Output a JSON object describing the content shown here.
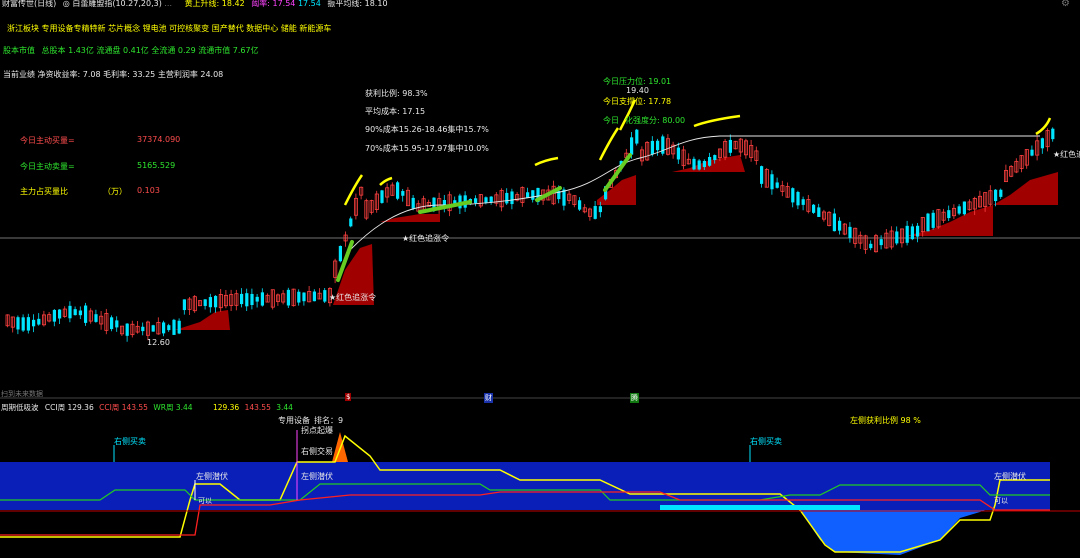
{
  "titlebar": {
    "app": "财富传世(日线)",
    "name": "◎ 白蕾雕盟指(10.27,20,3)",
    "extra": "...",
    "l1": "黄上升线: 18.42",
    "l2": "阈率: 17.54",
    "l3": "17.54",
    "l4": "振平均线: 18.10"
  },
  "info": {
    "line1": "浙江板块  专用设备专精特新 芯片概念 锂电池 可控核聚变 国产替代 数据中心 储能 新能源车",
    "line2_label": "股本市值",
    "line2": "总股本 1.43亿  流通盘 0.41亿 全流通  0.29 流通市值 7.67亿",
    "line3": "当前业绩  净资收益率: 7.08  毛利率: 33.25  主营利润率 24.08"
  },
  "left_stats": [
    {
      "label": "今日主动买量=",
      "value": "37374.090",
      "color": "#ff4d4d"
    },
    {
      "label": "今日主动卖量=",
      "value": "5165.529",
      "color": "#2ee62e"
    },
    {
      "label": "主力占买量比",
      "unit": "（万）",
      "value": "0.103",
      "color": "#ffff00"
    }
  ],
  "center_stats": [
    "获利比例: 98.3%",
    "平均成本: 17.15",
    "90%成本15.26-18.46集中15.7%",
    "70%成本15.95-17.97集中10.0%"
  ],
  "right_stats": {
    "pressure": "今日压力位: 19.01",
    "price_top": "19.40",
    "support": "今日支撑位: 17.78",
    "today_prefix": "今日",
    "strength": "化强度分: 80.00"
  },
  "chart_labels": {
    "low_price": "12.60",
    "sig1": "★红色追涨令",
    "sig2": "★红色追涨令",
    "sig3": "★红色追..."
  },
  "divider": {
    "left": "扫到未来数据",
    "markers": [
      "$",
      "财",
      "腾"
    ]
  },
  "sub": {
    "title": "周期低吸波",
    "cci_label": "CCI周",
    "cci": "129.36",
    "cci_g_label": "CCI周",
    "cci_g": "143.55",
    "wr_label": "WR周",
    "wr": "3.44",
    "extra1": "129.36",
    "extra2": "143.55",
    "extra3": "3.44",
    "center_a": "专用设备",
    "center_b": "排名：9",
    "right": "左侧获利比例 98 %",
    "labels": {
      "buy_right1": "右侧买卖",
      "buy_right2": "右侧买卖",
      "left_lurk1": "左侧潜伏",
      "left_lurk2": "左侧潜伏",
      "left_lurk3": "左侧潜伏",
      "swing": "拐点起爆",
      "right_trade": "右侧交易",
      "box1": "可以",
      "box2": "可以"
    }
  },
  "colors": {
    "up": "#ff4040",
    "down": "#00e5ff",
    "ma": "#e8e8e8",
    "chip": "#a00000",
    "band": "#0a1fb8",
    "line_yellow": "#ffff00",
    "line_green": "#22cc22"
  }
}
